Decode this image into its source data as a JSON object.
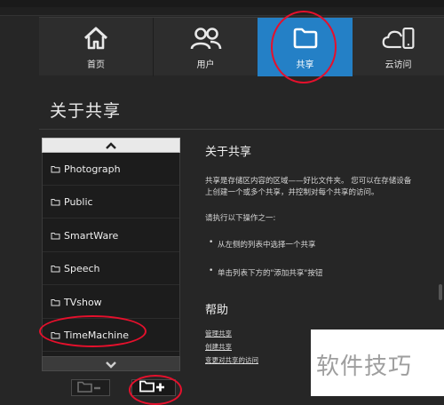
{
  "nav": {
    "items": [
      {
        "label": "首页",
        "icon": "home-icon"
      },
      {
        "label": "用户",
        "icon": "users-icon"
      },
      {
        "label": "共享",
        "icon": "folder-icon",
        "active": true
      },
      {
        "label": "云访问",
        "icon": "cloud-access-icon"
      }
    ]
  },
  "page": {
    "title": "关于共享"
  },
  "shares": {
    "items": [
      "Photograph",
      "Public",
      "SmartWare",
      "Speech",
      "TVshow",
      "TimeMachine"
    ]
  },
  "info": {
    "title": "关于共享",
    "description": "共享是存储区内容的区域——好比文件夹。 您可以在存储设备上创建一个或多个共享，并控制对每个共享的访问。",
    "instruction": "请执行以下操作之一:",
    "bullets": [
      "从左侧的列表中选择一个共享",
      "单击列表下方的\"添加共享\"按钮"
    ]
  },
  "help": {
    "title": "帮助",
    "links": [
      "管理共享",
      "创建共享",
      "变更对共享的访问"
    ]
  },
  "watermark": {
    "text": "软件技巧"
  },
  "colors": {
    "accent": "#2480c6",
    "annotation": "#e5102c",
    "background": "#262626"
  }
}
